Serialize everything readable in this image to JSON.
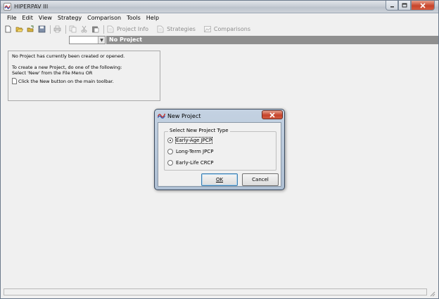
{
  "window": {
    "title": "HIPERPAV III"
  },
  "menu": [
    "File",
    "Edit",
    "View",
    "Strategy",
    "Comparison",
    "Tools",
    "Help"
  ],
  "toolbar": {
    "project_info": "Project Info",
    "strategies": "Strategies",
    "comparisons": "Comparisons"
  },
  "project_bar": {
    "selected": "",
    "title": "No Project"
  },
  "info_panel": {
    "line1": "No Project has currently been created or opened.",
    "line2": "To create a new Project, do one of the following:",
    "line3": "Select 'New' from the File Menu OR",
    "line4": "Click the New button on the main toolbar."
  },
  "dialog": {
    "title": "New Project",
    "group_label": "Select New Project Type",
    "options": [
      {
        "label": "Early-Age JPCP",
        "checked": true
      },
      {
        "label": "Long-Term JPCP",
        "checked": false
      },
      {
        "label": "Early-Life CRCP",
        "checked": false
      }
    ],
    "ok_label": "OK",
    "cancel_label": "Cancel"
  },
  "colors": {
    "title_bar": "#c9ced6",
    "close_button": "#c7452c",
    "project_header": "#8f8f8f",
    "dialog_frame": "#aebfd3"
  }
}
